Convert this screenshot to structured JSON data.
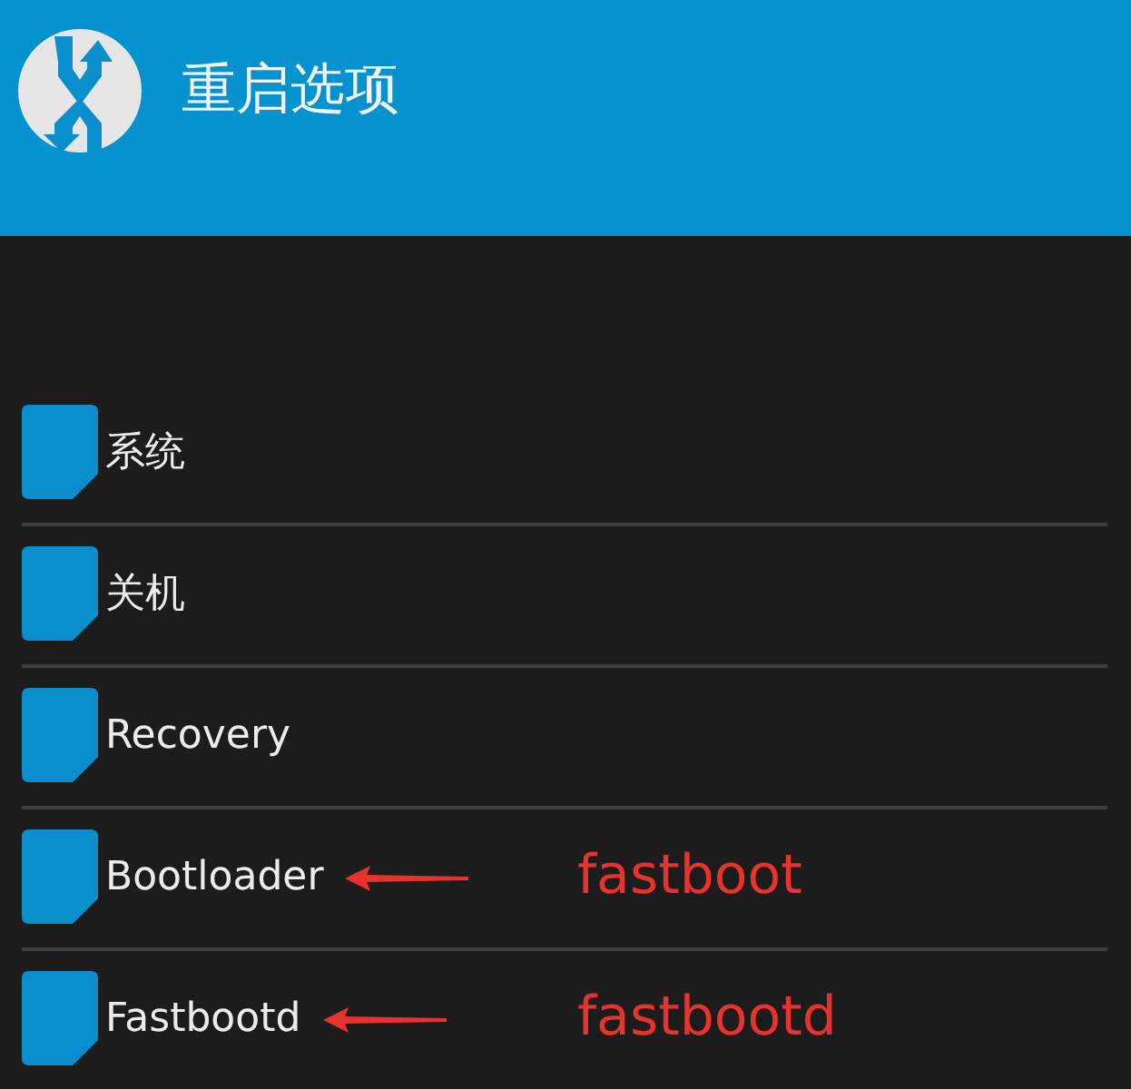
{
  "header": {
    "title": "重启选项"
  },
  "items": [
    {
      "label": "系统"
    },
    {
      "label": "关机"
    },
    {
      "label": "Recovery"
    },
    {
      "label": "Bootloader",
      "annotation": "fastboot"
    },
    {
      "label": "Fastbootd",
      "annotation": "fastbootd"
    }
  ]
}
